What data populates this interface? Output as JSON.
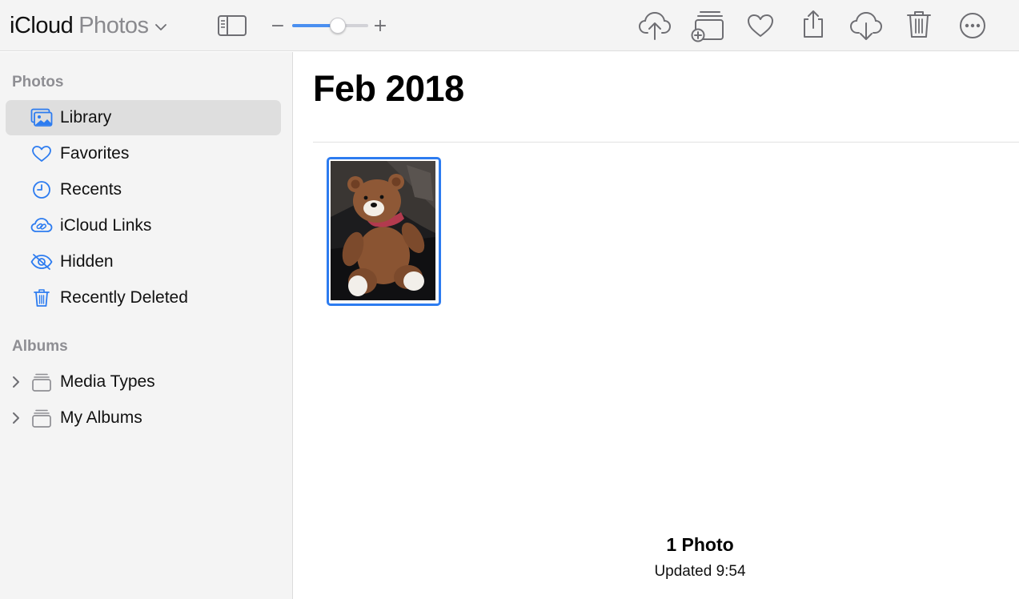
{
  "app": {
    "title_brand": "iCloud",
    "title_product": "Photos"
  },
  "colors": {
    "accent": "#2d7cf0",
    "icon_gray": "#6e6e73",
    "sidebar_bg": "#f4f4f4",
    "selected_bg": "#dedede"
  },
  "toolbar": {
    "zoom": {
      "minus": "−",
      "plus": "+",
      "level": 0.6
    },
    "icons": [
      "sidebar-toggle-icon",
      "upload-icon",
      "add-to-album-icon",
      "heart-icon",
      "share-icon",
      "download-icon",
      "trash-icon",
      "more-icon"
    ]
  },
  "sidebar": {
    "photos_header": "Photos",
    "items": [
      {
        "label": "Library",
        "icon": "library-icon",
        "selected": true
      },
      {
        "label": "Favorites",
        "icon": "heart-icon"
      },
      {
        "label": "Recents",
        "icon": "clock-icon"
      },
      {
        "label": "iCloud Links",
        "icon": "cloud-link-icon"
      },
      {
        "label": "Hidden",
        "icon": "eye-slash-icon"
      },
      {
        "label": "Recently Deleted",
        "icon": "trash-icon"
      }
    ],
    "albums_header": "Albums",
    "albums": [
      {
        "label": "Media Types",
        "icon": "album-stack-icon"
      },
      {
        "label": "My Albums",
        "icon": "album-stack-icon"
      }
    ]
  },
  "main": {
    "heading": "Feb 2018",
    "photo_count": "1 Photo",
    "updated": "Updated 9:54"
  }
}
